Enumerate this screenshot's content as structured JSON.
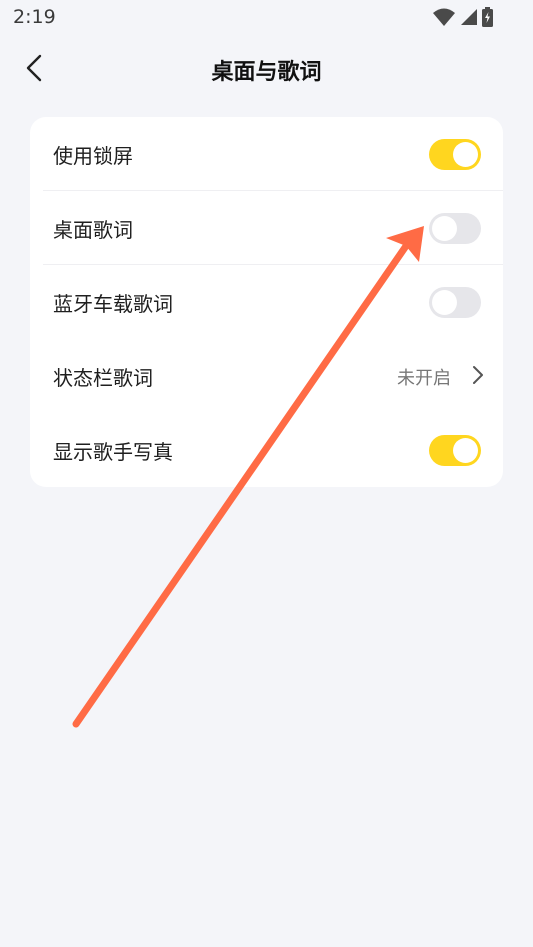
{
  "status_bar": {
    "time": "2:19",
    "icons": [
      "wifi-icon",
      "cellular-signal-icon",
      "battery-charging-icon"
    ]
  },
  "header": {
    "back_icon": "chevron-left-icon",
    "title": "桌面与歌词"
  },
  "settings": {
    "lock_screen": {
      "label": "使用锁屏",
      "enabled": true
    },
    "desktop_lyrics": {
      "label": "桌面歌词",
      "enabled": false
    },
    "bluetooth_lyrics": {
      "label": "蓝牙车载歌词",
      "enabled": false
    },
    "statusbar_lyrics": {
      "label": "状态栏歌词",
      "value": "未开启",
      "icon": "chevron-right-icon"
    },
    "singer_photo": {
      "label": "显示歌手写真",
      "enabled": true
    }
  },
  "colors": {
    "background": "#f4f5f9",
    "toggle_on": "#ffd61f",
    "toggle_off": "#e6e6ea",
    "annotation_arrow": "#ff6b45"
  }
}
